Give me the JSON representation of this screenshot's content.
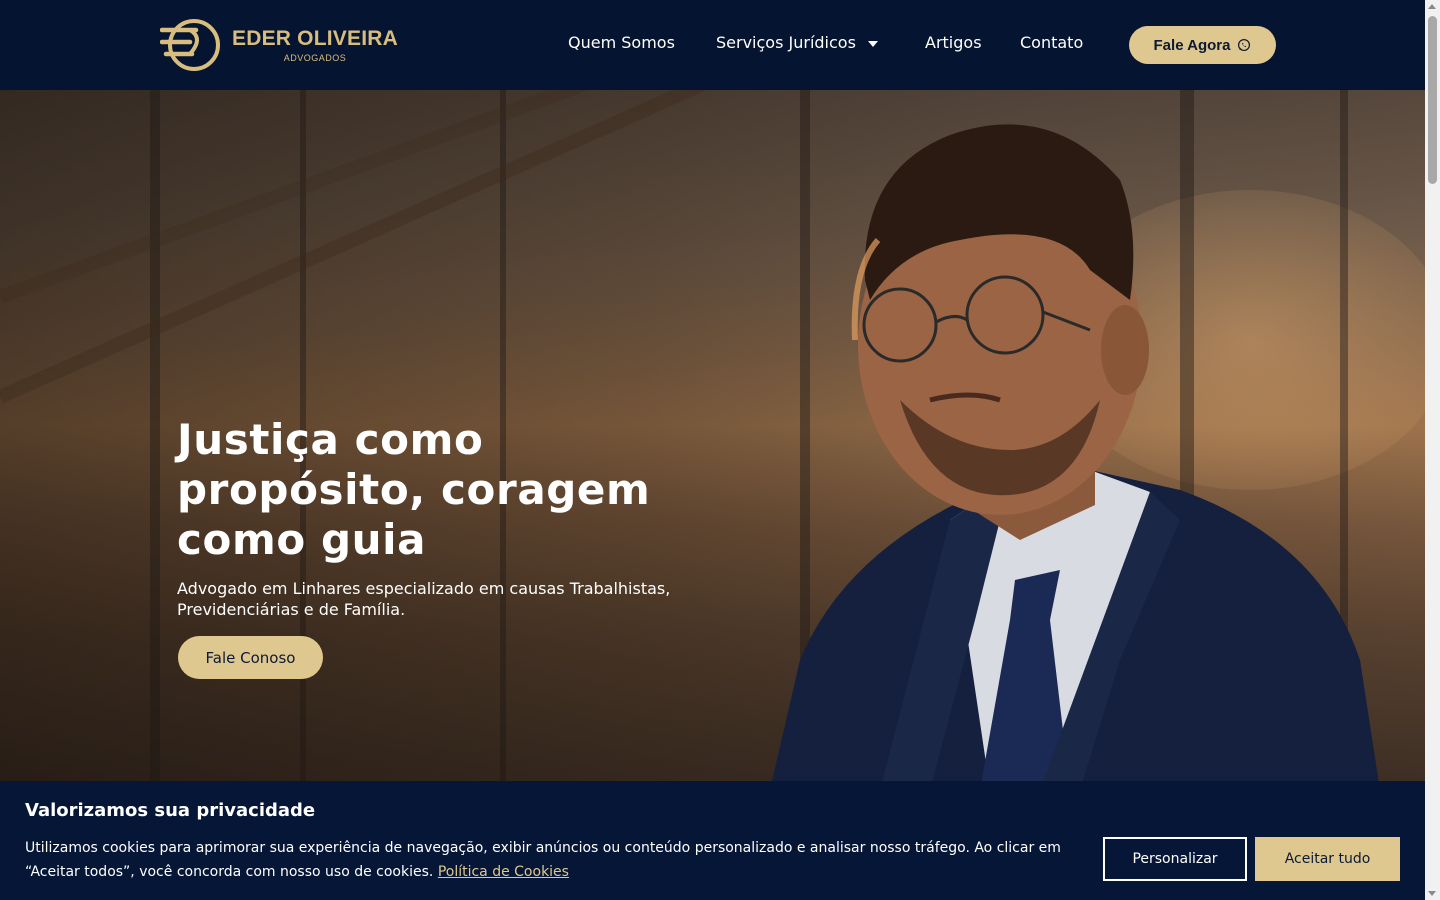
{
  "header": {
    "logo_name": "EDER OLIVEIRA",
    "logo_sub": "ADVOGADOS",
    "nav": [
      {
        "label": "Quem Somos"
      },
      {
        "label": "Serviços Jurídicos",
        "has_dropdown": true
      },
      {
        "label": "Artigos"
      },
      {
        "label": "Contato"
      }
    ],
    "cta_label": "Fale Agora",
    "cta_icon": "whatsapp-icon"
  },
  "hero": {
    "title": "Justiça como propósito, coragem como guia",
    "subtitle": "Advogado em Linhares especializado em causas Trabalhistas, Previdenciárias e de Família.",
    "button_label": "Fale Conoso"
  },
  "cookie": {
    "title": "Valorizamos sua privacidade",
    "text": "Utilizamos cookies para aprimorar sua experiência de navegação, exibir anúncios ou conteúdo personalizado e analisar nosso tráfego. Ao clicar em “Aceitar todos”, você concorda com nosso uso de cookies.",
    "link_label": "Política de Cookies",
    "customize_label": "Personalizar",
    "accept_label": "Aceitar tudo"
  },
  "colors": {
    "navy": "#051431",
    "gold": "#dfc88f",
    "logo_gold": "#d8bd7f"
  }
}
